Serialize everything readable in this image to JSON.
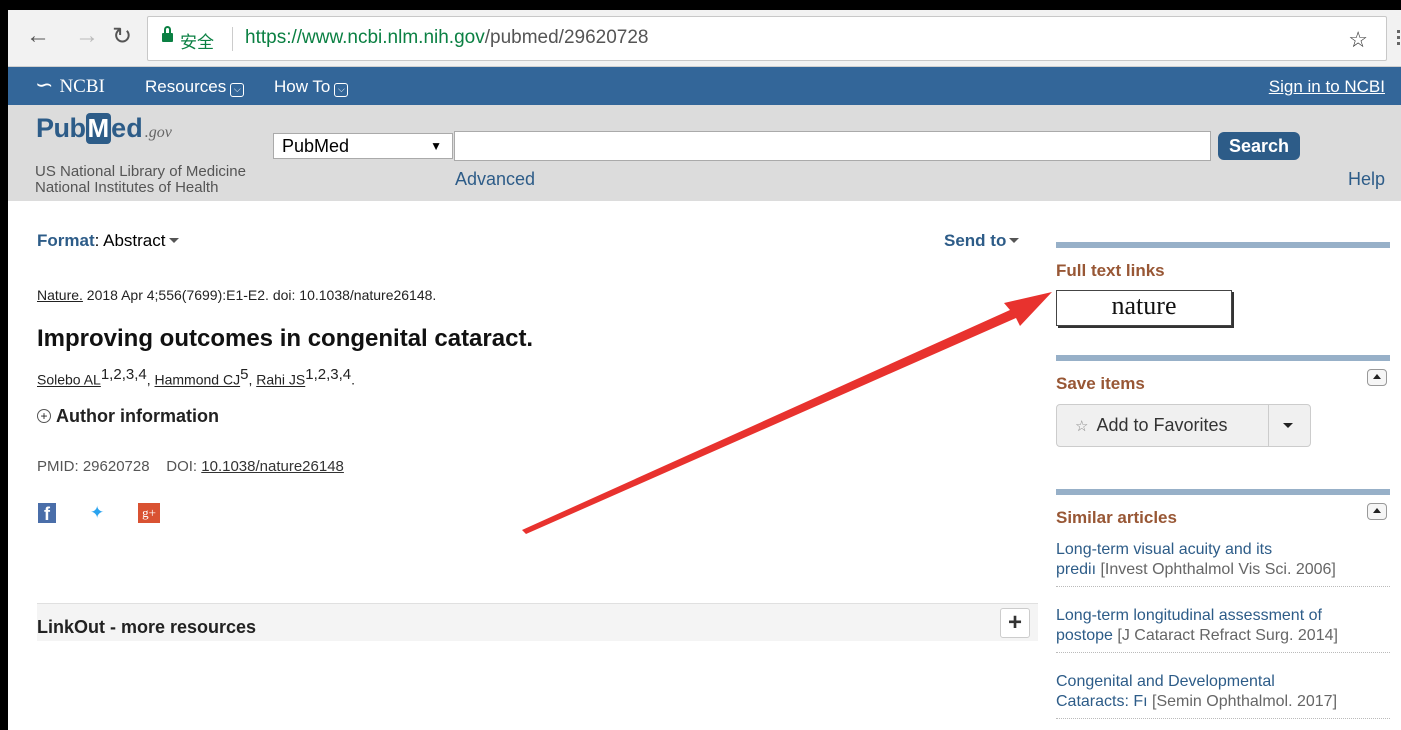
{
  "browser": {
    "secure_label": "安全",
    "url_host": "https://www.ncbi.nlm.nih.gov",
    "url_path": "/pubmed/29620728"
  },
  "ncbi": {
    "logo": "NCBI",
    "resources": "Resources",
    "howto": "How To",
    "sign_in": "Sign in to NCBI"
  },
  "pubmed": {
    "logo_pub": "Pub",
    "logo_m": "M",
    "logo_ed": "ed",
    "logo_gov": ".gov",
    "subtitle": "US National Library of Medicine National Institutes of Health",
    "db_selected": "PubMed",
    "search_value": "",
    "search_button": "Search",
    "advanced": "Advanced",
    "help": "Help"
  },
  "article": {
    "format_label": "Format",
    "format_value": ": Abstract",
    "send_to": "Send to",
    "journal": "Nature.",
    "citation_rest": " 2018 Apr 4;556(7699):E1-E2. doi: 10.1038/nature26148.",
    "title": "Improving outcomes in congenital cataract.",
    "authors": [
      {
        "name": "Solebo AL",
        "sup": "1,2,3,4",
        "sep": ", "
      },
      {
        "name": "Hammond CJ",
        "sup": "5",
        "sep": ", "
      },
      {
        "name": "Rahi JS",
        "sup": "1,2,3,4",
        "sep": "."
      }
    ],
    "author_info": "Author information",
    "pmid": "PMID: 29620728",
    "doi_label": "DOI:",
    "doi": "10.1038/nature26148",
    "linkout": "LinkOut - more resources"
  },
  "sidebar": {
    "full_text_links": "Full text links",
    "nature_logo": "nature",
    "save_items": "Save items",
    "add_to_favorites": "Add to Favorites",
    "similar_articles": "Similar articles",
    "similar": [
      {
        "line1": "Long-term visual acuity and its",
        "line2a": "prediı",
        "journal": "[Invest Ophthalmol Vis Sci. 2006]"
      },
      {
        "line1": "Long-term longitudinal assessment of",
        "line2a": "postope",
        "journal": "[J Cataract Refract Surg. 2014]"
      },
      {
        "line1": "Congenital and Developmental",
        "line2a": "Cataracts: Fı",
        "journal": "[Semin Ophthalmol. 2017]"
      }
    ]
  },
  "colors": {
    "ncbi_blue": "#336699",
    "pubmed_blue": "#2d5c88",
    "sidebar_heading": "#985735",
    "annotation_arrow": "#e8322e"
  }
}
